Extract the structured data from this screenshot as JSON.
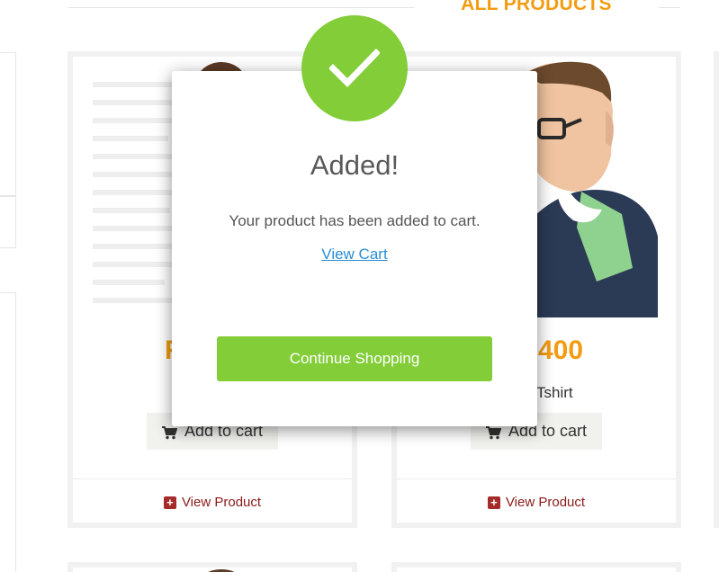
{
  "page": {
    "section_heading": "ALL PRODUCTS"
  },
  "products": [
    {
      "price": "R",
      "name": "",
      "add_to_cart_label": "Add to cart",
      "view_product_label": "View Product"
    },
    {
      "price": "400",
      "name": "Tshirt",
      "add_to_cart_label": "Add to cart",
      "view_product_label": "View Product"
    }
  ],
  "modal": {
    "title": "Added!",
    "message": "Your product has been added to cart.",
    "view_cart_label": "View Cart",
    "continue_label": "Continue Shopping",
    "icon": "checkmark-icon"
  },
  "colors": {
    "accent_orange": "#f39c12",
    "success_green": "#82cd38",
    "link_blue": "#2a8dd4",
    "view_product_red": "#8b1a1a"
  }
}
